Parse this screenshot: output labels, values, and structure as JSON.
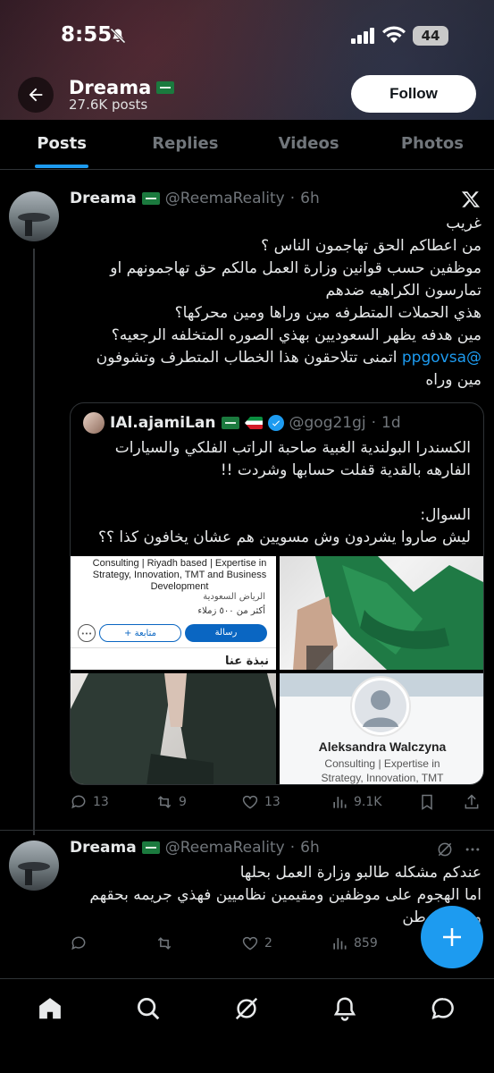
{
  "status_bar": {
    "time": "8:55",
    "battery": "44"
  },
  "profile": {
    "name": "Dreama",
    "post_count": "27.6K posts",
    "follow_label": "Follow"
  },
  "tabs": [
    {
      "label": "Posts",
      "active": true
    },
    {
      "label": "Replies",
      "active": false
    },
    {
      "label": "Videos",
      "active": false
    },
    {
      "label": "Photos",
      "active": false
    }
  ],
  "tweet1": {
    "name": "Dreama",
    "handle": "@ReemaReality",
    "time": "6h",
    "lines": [
      "غريب",
      "من اعطاكم الحق تهاجمون الناس ؟",
      "موظفين حسب قوانين وزارة العمل مالكم حق تهاجمونهم او",
      "تمارسون الكراهيه ضدهم",
      "هذي الحملات المتطرفه مين وراها ومين محركها؟",
      "مين هدفه يظهر السعوديين بهذي الصوره المتخلفه الرجعيه؟",
      "اتمنى تتلاحقون هذا الخطاب المتطرف وتشوفون",
      "مين وراه"
    ],
    "mention": "@ppgovsa",
    "quote": {
      "name": "IAl.ajamiLan",
      "handle": "@gog21gj",
      "time": "1d",
      "lines": [
        "الكسندرا البولندية الغبية صاحبة الراتب الفلكي  والسيارات",
        "الفارهه بالقدية قفلت حسابها وشردت !!",
        "",
        "السوال:",
        "ليش صاروا يشردون وش مسويين هم عشان يخافون كذا ؟؟"
      ],
      "media": {
        "m1_text": "Consulting | Riyadh based | Expertise in Strategy, Innovation, TMT and Business Development",
        "m1_location": "الرياض السعودية",
        "m1_connections": "أكثر من ٥٠٠ زملاء",
        "m1_message": "رسالة",
        "m1_follow": "+ متابعة",
        "m1_more": "•••",
        "m1_bottom": "نبذة عنا",
        "m4_name": "Aleksandra Walczyna",
        "m4_sub1": "Consulting | Expertise in",
        "m4_sub2": "Strategy, Innovation, TMT"
      }
    },
    "stats": {
      "replies": "13",
      "reposts": "9",
      "likes": "13",
      "views": "9.1K"
    }
  },
  "tweet2": {
    "name": "Dreama",
    "handle": "@ReemaReality",
    "time": "6h",
    "lines": [
      "عندكم مشكله طالبو وزارة العمل بحلها",
      "اما الهجوم على موظفين ومقيمين نظاميين فهذي جريمه بحقهم",
      "وبحق الوطن"
    ],
    "stats": {
      "replies": "",
      "reposts": "",
      "likes": "2",
      "views": "859"
    }
  },
  "colors": {
    "accent": "#1d9bf0",
    "background": "#000000",
    "muted": "#71767b"
  }
}
